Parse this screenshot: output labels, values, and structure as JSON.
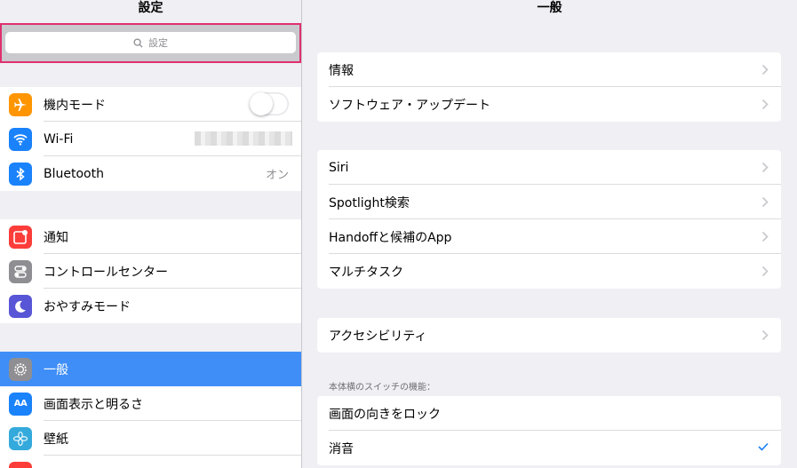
{
  "sidebar": {
    "title": "設定",
    "search_placeholder": "設定",
    "group1": [
      {
        "label": "機内モード",
        "icon": "airplane-icon",
        "color": "#ff9500",
        "accessory": "toggle"
      },
      {
        "label": "Wi-Fi",
        "icon": "wifi-icon",
        "color": "#1a82fb",
        "accessory": "blurred-value"
      },
      {
        "label": "Bluetooth",
        "icon": "bluetooth-icon",
        "color": "#1a82fb",
        "value": "オン"
      }
    ],
    "group2": [
      {
        "label": "通知",
        "icon": "notifications-icon",
        "color": "#fc3d39"
      },
      {
        "label": "コントロールセンター",
        "icon": "control-center-icon",
        "color": "#8e8e93"
      },
      {
        "label": "おやすみモード",
        "icon": "moon-icon",
        "color": "#5856d6"
      }
    ],
    "group3": [
      {
        "label": "一般",
        "icon": "gear-icon",
        "color": "#8e8e93",
        "selected": true
      },
      {
        "label": "画面表示と明るさ",
        "icon": "display-icon",
        "color": "#1a82fb"
      },
      {
        "label": "壁紙",
        "icon": "wallpaper-icon",
        "color": "#34aadc"
      }
    ]
  },
  "detail": {
    "title": "一般",
    "group1": [
      "情報",
      "ソフトウェア・アップデート"
    ],
    "group2": [
      "Siri",
      "Spotlight検索",
      "Handoffと候補のApp",
      "マルチタスク"
    ],
    "group3": [
      "アクセシビリティ"
    ],
    "switch_header": "本体横のスイッチの機能：",
    "group4": [
      "画面の向きをロック",
      "消音"
    ]
  },
  "colors": {
    "accent": "#3f8ef7",
    "highlight_border": "#e0306e",
    "checkmark": "#1a7ef5"
  }
}
